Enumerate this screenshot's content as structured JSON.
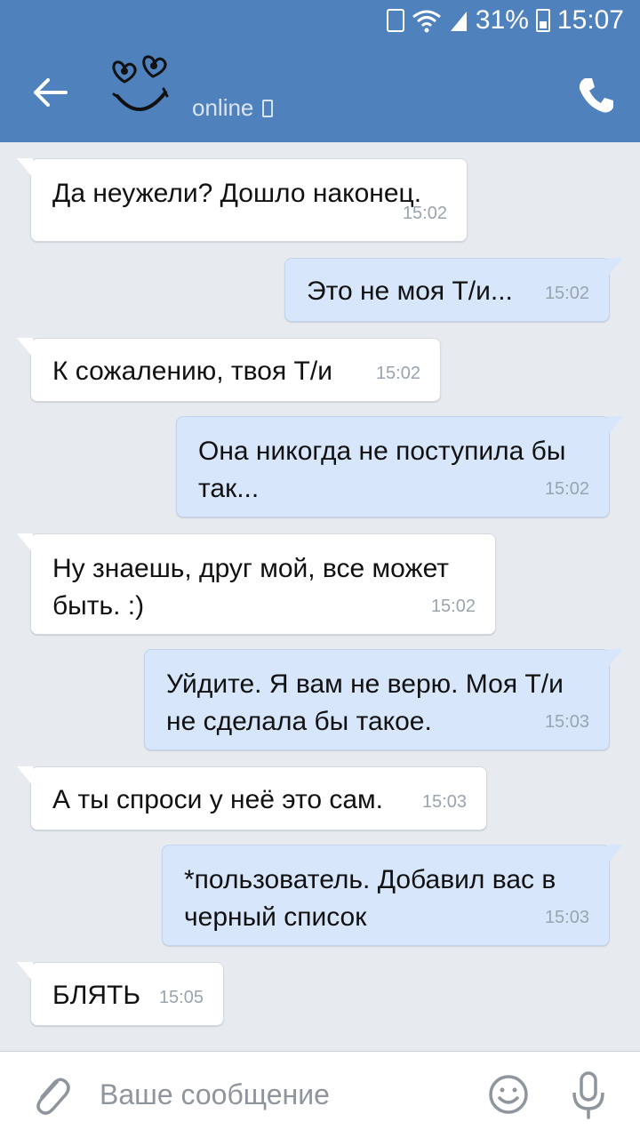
{
  "status_bar": {
    "battery_percent": "31%",
    "time": "15:07"
  },
  "header": {
    "status": "online"
  },
  "messages": [
    {
      "dir": "in",
      "text": "Да неужели? Дошло наконец.",
      "time": "15:02"
    },
    {
      "dir": "out",
      "text": "Это не моя Т/и...",
      "time": "15:02"
    },
    {
      "dir": "in",
      "text": "К сожалению, твоя Т/и",
      "time": "15:02"
    },
    {
      "dir": "out",
      "text": "Она никогда не поступила бы\nтак...",
      "time": "15:02"
    },
    {
      "dir": "in",
      "text": "Ну знаешь, друг мой, все может\nбыть. :)",
      "time": "15:02"
    },
    {
      "dir": "out",
      "text": "Уйдите. Я вам не верю. Моя Т/и\nне сделала бы такое.",
      "time": "15:03"
    },
    {
      "dir": "in",
      "text": "А ты спроси у неё это сам.",
      "time": "15:03"
    },
    {
      "dir": "out",
      "text": "*пользователь. Добавил вас в\nчерный список",
      "time": "15:03"
    },
    {
      "dir": "in",
      "text": "БЛЯТЬ",
      "time": "15:05"
    }
  ],
  "composer": {
    "placeholder": "Ваше сообщение"
  },
  "colors": {
    "header_bg": "#4f81bd",
    "chat_bg": "#e7ebf0",
    "incoming_bg": "#ffffff",
    "outgoing_bg": "#d7e6fb"
  },
  "icons": [
    "recycle-icon",
    "wifi-icon",
    "signal-icon",
    "battery-icon",
    "back-arrow-icon",
    "avatar-hearts-smiley",
    "mobile-icon",
    "phone-icon",
    "paperclip-icon",
    "emoji-icon",
    "microphone-icon"
  ]
}
